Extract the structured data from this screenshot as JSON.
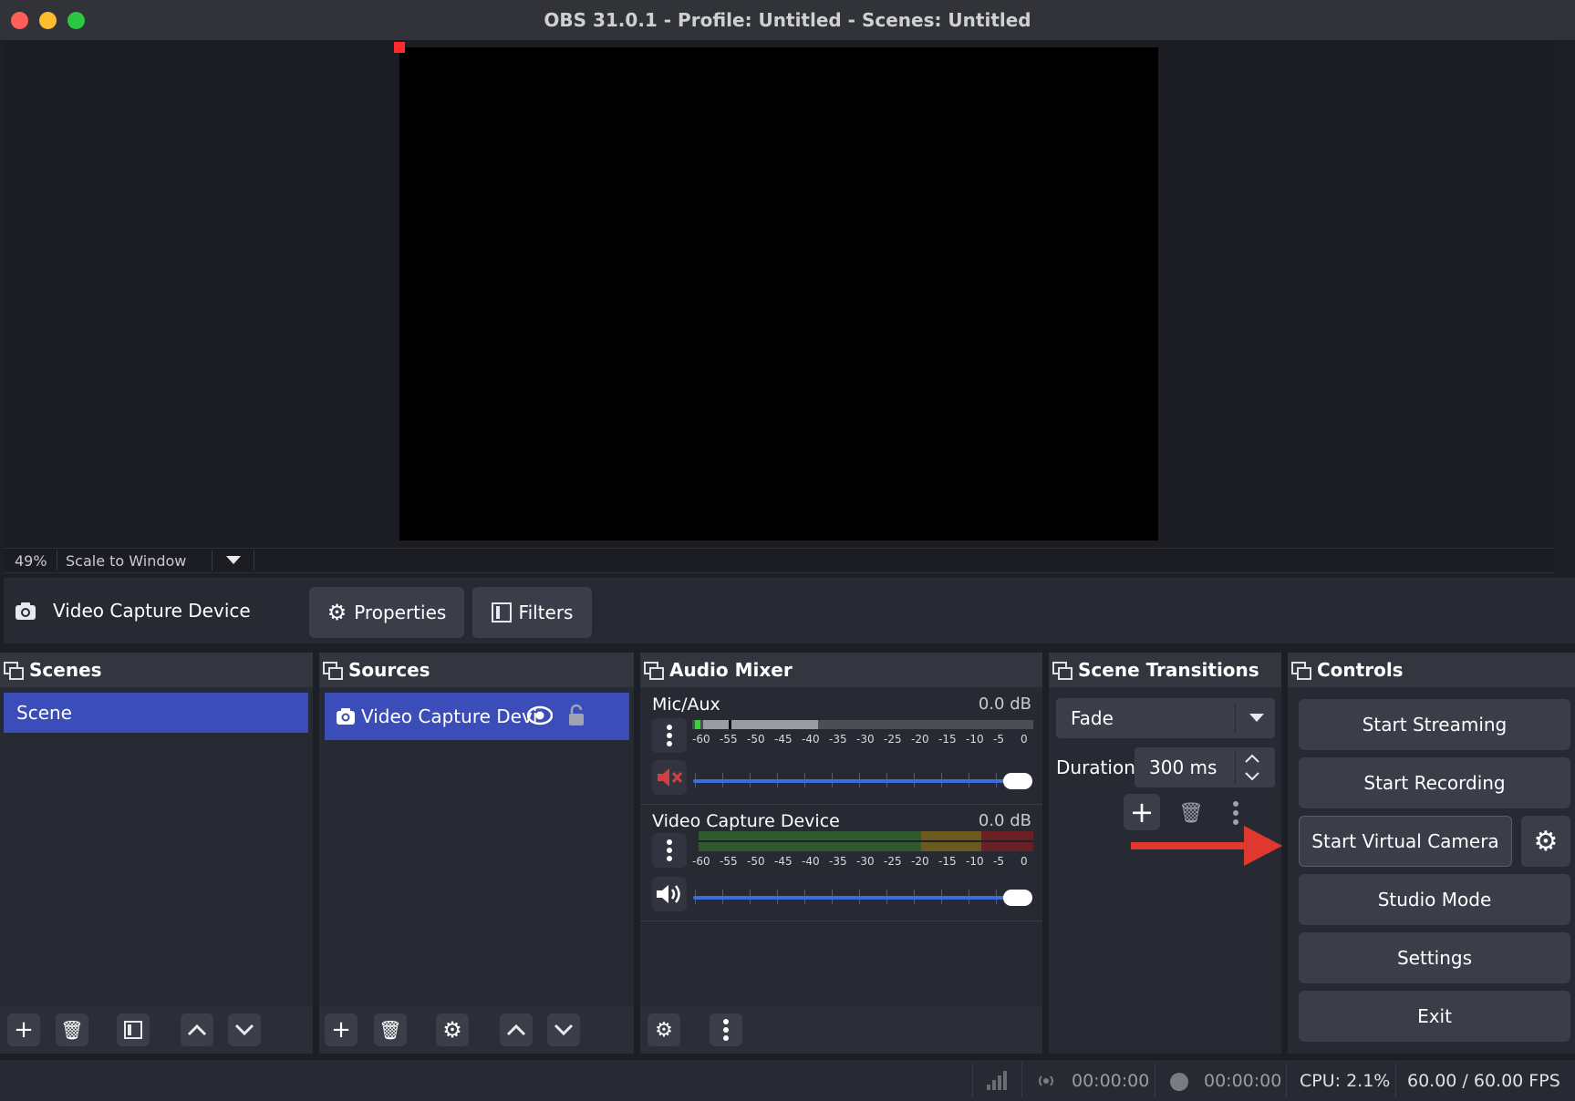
{
  "window": {
    "title": "OBS 31.0.1 - Profile: Untitled - Scenes: Untitled"
  },
  "preview": {
    "zoom": "49%",
    "scale_mode": "Scale to Window"
  },
  "context_bar": {
    "source_name": "Video Capture Device",
    "properties_label": "Properties",
    "filters_label": "Filters"
  },
  "scenes": {
    "title": "Scenes",
    "items": [
      "Scene"
    ]
  },
  "sources": {
    "title": "Sources",
    "items": [
      "Video Capture Devi"
    ]
  },
  "audio_mixer": {
    "title": "Audio Mixer",
    "ticks": [
      "-60",
      "-55",
      "-50",
      "-45",
      "-40",
      "-35",
      "-30",
      "-25",
      "-20",
      "-15",
      "-10",
      "-5",
      "0"
    ],
    "channels": [
      {
        "name": "Mic/Aux",
        "level": "0.0 dB",
        "muted": true
      },
      {
        "name": "Video Capture Device",
        "level": "0.0 dB",
        "muted": false
      }
    ]
  },
  "scene_transitions": {
    "title": "Scene Transitions",
    "transition": "Fade",
    "duration_label": "Duration",
    "duration_value": "300 ms"
  },
  "controls": {
    "title": "Controls",
    "start_streaming": "Start Streaming",
    "start_recording": "Start Recording",
    "start_virtual_camera": "Start Virtual Camera",
    "studio_mode": "Studio Mode",
    "settings": "Settings",
    "exit": "Exit"
  },
  "status": {
    "stream_time": "00:00:00",
    "record_time": "00:00:00",
    "cpu": "CPU: 2.1%",
    "fps": "60.00 / 60.00 FPS"
  },
  "colors": {
    "accent": "#3b4db8",
    "arrow": "#e0382e",
    "muted": "#d04040"
  }
}
